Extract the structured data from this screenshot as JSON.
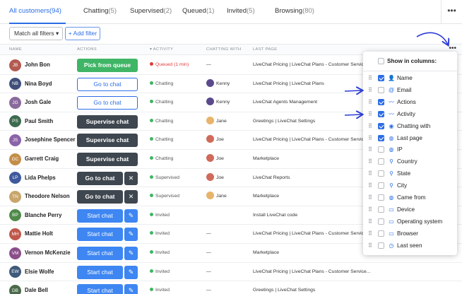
{
  "tabs": [
    {
      "label": "All customers",
      "count": "(94)"
    },
    {
      "label": "Chatting",
      "count": "(5)"
    },
    {
      "label": "Supervised",
      "count": "(2)"
    },
    {
      "label": "Queued",
      "count": "(1)"
    },
    {
      "label": "Invited",
      "count": "(5)"
    },
    {
      "label": "Browsing",
      "count": "(80)"
    }
  ],
  "more_label": "•••",
  "filters": {
    "match_label": "Match all filters ▾",
    "add_label": "+ Add filter"
  },
  "columns": {
    "name": "NAME",
    "actions": "ACTIONS",
    "activity": "▾ ACTIVITY",
    "chatting_with": "CHATTING WITH",
    "last_page": "LAST PAGE"
  },
  "colors": {
    "accent": "#2c6de6",
    "queued": "#e23b3b",
    "chatting": "#3fb565",
    "invited": "#3fb565",
    "supervised": "#3fb565"
  },
  "rows": [
    {
      "initials": "JB",
      "avatar_color": "#b35a50",
      "name": "John Bon",
      "action": "Pick from queue",
      "status": "Queued (1 min)",
      "status_color": "#e23b3b",
      "chatting_with": "—",
      "last_page": "LiveChat Pricing | LiveChat Plans - Customer Service..."
    },
    {
      "initials": "NB",
      "avatar_color": "#3f4f7a",
      "name": "Nina Boyd",
      "action": "Go to chat",
      "status": "Chatting",
      "status_color": "#3fb565",
      "chatting_with": "Kenny",
      "last_page": "LiveChat Pricing | LiveChat Plans"
    },
    {
      "initials": "JG",
      "avatar_color": "#8a6a9c",
      "name": "Josh Gale",
      "action": "Go to chat",
      "status": "Chatting",
      "status_color": "#3fb565",
      "chatting_with": "Kenny",
      "last_page": "LiveChat Agents Management"
    },
    {
      "initials": "PS",
      "avatar_color": "#3d6b4f",
      "name": "Paul Smith",
      "action": "Supervise chat",
      "status": "Chatting",
      "status_color": "#3fb565",
      "chatting_with": "Jane",
      "last_page": "Greetings | LiveChat Settings"
    },
    {
      "initials": "JS",
      "avatar_color": "#8a63a8",
      "name": "Josephine Spencer",
      "action": "Supervise chat",
      "status": "Chatting",
      "status_color": "#3fb565",
      "chatting_with": "Joe",
      "last_page": "LiveChat Pricing | LiveChat Plans - Customer Service..."
    },
    {
      "initials": "GC",
      "avatar_color": "#c48e4a",
      "name": "Garrett Craig",
      "action": "Supervise chat",
      "status": "Chatting",
      "status_color": "#3fb565",
      "chatting_with": "Joe",
      "last_page": "Marketplace"
    },
    {
      "initials": "LP",
      "avatar_color": "#3f5a9c",
      "name": "Lida Phelps",
      "action": "Go to chat",
      "status": "Supervised",
      "status_color": "#3fb565",
      "chatting_with": "Joe",
      "last_page": "LiveChat Reports"
    },
    {
      "initials": "TN",
      "avatar_color": "#c8a56a",
      "name": "Theodore Nelson",
      "action": "Go to chat",
      "status": "Supervised",
      "status_color": "#3fb565",
      "chatting_with": "Jane",
      "last_page": "Marketplace"
    },
    {
      "initials": "BP",
      "avatar_color": "#4f8a4a",
      "name": "Blanche Perry",
      "action": "Start chat",
      "status": "Invited",
      "status_color": "#3fb565",
      "chatting_with": "",
      "last_page": "Install LiveChat code"
    },
    {
      "initials": "MH",
      "avatar_color": "#c0584a",
      "name": "Mattie Holt",
      "action": "Start chat",
      "status": "Invited",
      "status_color": "#3fb565",
      "chatting_with": "—",
      "last_page": "LiveChat Pricing | LiveChat Plans - Customer Service..."
    },
    {
      "initials": "VM",
      "avatar_color": "#8a4f8a",
      "name": "Vernon McKenzie",
      "action": "Start chat",
      "status": "Invited",
      "status_color": "#3fb565",
      "chatting_with": "—",
      "last_page": "Marketplace"
    },
    {
      "initials": "EW",
      "avatar_color": "#3f5a7a",
      "name": "Elsie Wolfe",
      "action": "Start chat",
      "status": "Invited",
      "status_color": "#3fb565",
      "chatting_with": "—",
      "last_page": "LiveChat Pricing | LiveChat Plans - Customer Service..."
    },
    {
      "initials": "DB",
      "avatar_color": "#4a6a4a",
      "name": "Dale Bell",
      "action": "Start chat",
      "status": "Invited",
      "status_color": "#3fb565",
      "chatting_with": "—",
      "last_page": "Greetings | LiveChat Settings"
    }
  ],
  "agents": {
    "Kenny": "#5a4a8c",
    "Jane": "#e8b46a",
    "Joe": "#d06a5a"
  },
  "column_panel": {
    "title": "Show in columns:",
    "items": [
      {
        "label": "Name",
        "checked": true,
        "icon": "👤"
      },
      {
        "label": "Email",
        "checked": false,
        "icon": "@"
      },
      {
        "label": "Actions",
        "checked": true,
        "icon": "〰"
      },
      {
        "label": "Activity",
        "checked": true,
        "icon": "〰"
      },
      {
        "label": "Chatting with",
        "checked": true,
        "icon": "◉"
      },
      {
        "label": "Last page",
        "checked": true,
        "icon": "◍"
      },
      {
        "label": "IP",
        "checked": false,
        "icon": "◍"
      },
      {
        "label": "Country",
        "checked": false,
        "icon": "⚲"
      },
      {
        "label": "State",
        "checked": false,
        "icon": "⚲"
      },
      {
        "label": "City",
        "checked": false,
        "icon": "⚲"
      },
      {
        "label": "Came from",
        "checked": false,
        "icon": "◍"
      },
      {
        "label": "Device",
        "checked": false,
        "icon": "▭"
      },
      {
        "label": "Operating system",
        "checked": false,
        "icon": "▭"
      },
      {
        "label": "Browser",
        "checked": false,
        "icon": "▭"
      },
      {
        "label": "Last seen",
        "checked": false,
        "icon": "◷"
      }
    ]
  }
}
